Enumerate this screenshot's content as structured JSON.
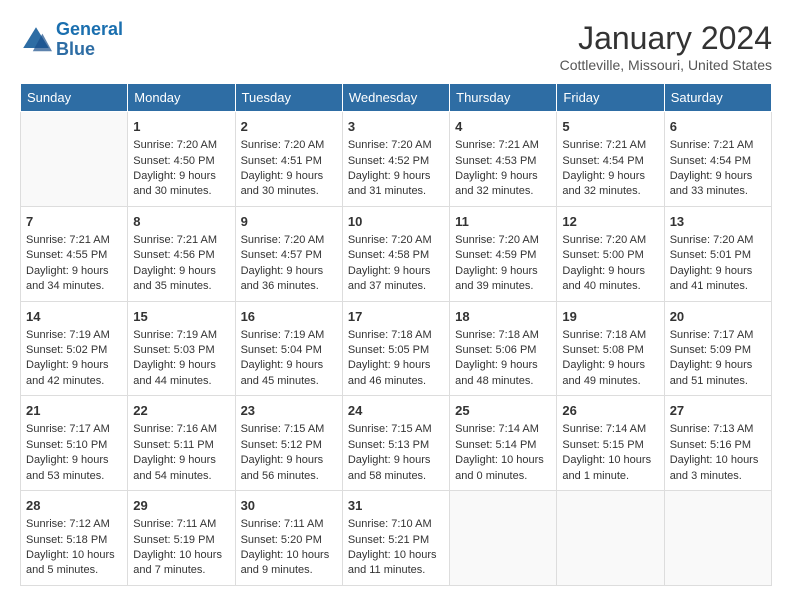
{
  "logo": {
    "line1": "General",
    "line2": "Blue"
  },
  "title": "January 2024",
  "subtitle": "Cottleville, Missouri, United States",
  "headers": [
    "Sunday",
    "Monday",
    "Tuesday",
    "Wednesday",
    "Thursday",
    "Friday",
    "Saturday"
  ],
  "weeks": [
    [
      {
        "day": "",
        "content": ""
      },
      {
        "day": "1",
        "content": "Sunrise: 7:20 AM\nSunset: 4:50 PM\nDaylight: 9 hours\nand 30 minutes."
      },
      {
        "day": "2",
        "content": "Sunrise: 7:20 AM\nSunset: 4:51 PM\nDaylight: 9 hours\nand 30 minutes."
      },
      {
        "day": "3",
        "content": "Sunrise: 7:20 AM\nSunset: 4:52 PM\nDaylight: 9 hours\nand 31 minutes."
      },
      {
        "day": "4",
        "content": "Sunrise: 7:21 AM\nSunset: 4:53 PM\nDaylight: 9 hours\nand 32 minutes."
      },
      {
        "day": "5",
        "content": "Sunrise: 7:21 AM\nSunset: 4:54 PM\nDaylight: 9 hours\nand 32 minutes."
      },
      {
        "day": "6",
        "content": "Sunrise: 7:21 AM\nSunset: 4:54 PM\nDaylight: 9 hours\nand 33 minutes."
      }
    ],
    [
      {
        "day": "7",
        "content": "Sunrise: 7:21 AM\nSunset: 4:55 PM\nDaylight: 9 hours\nand 34 minutes."
      },
      {
        "day": "8",
        "content": "Sunrise: 7:21 AM\nSunset: 4:56 PM\nDaylight: 9 hours\nand 35 minutes."
      },
      {
        "day": "9",
        "content": "Sunrise: 7:20 AM\nSunset: 4:57 PM\nDaylight: 9 hours\nand 36 minutes."
      },
      {
        "day": "10",
        "content": "Sunrise: 7:20 AM\nSunset: 4:58 PM\nDaylight: 9 hours\nand 37 minutes."
      },
      {
        "day": "11",
        "content": "Sunrise: 7:20 AM\nSunset: 4:59 PM\nDaylight: 9 hours\nand 39 minutes."
      },
      {
        "day": "12",
        "content": "Sunrise: 7:20 AM\nSunset: 5:00 PM\nDaylight: 9 hours\nand 40 minutes."
      },
      {
        "day": "13",
        "content": "Sunrise: 7:20 AM\nSunset: 5:01 PM\nDaylight: 9 hours\nand 41 minutes."
      }
    ],
    [
      {
        "day": "14",
        "content": "Sunrise: 7:19 AM\nSunset: 5:02 PM\nDaylight: 9 hours\nand 42 minutes."
      },
      {
        "day": "15",
        "content": "Sunrise: 7:19 AM\nSunset: 5:03 PM\nDaylight: 9 hours\nand 44 minutes."
      },
      {
        "day": "16",
        "content": "Sunrise: 7:19 AM\nSunset: 5:04 PM\nDaylight: 9 hours\nand 45 minutes."
      },
      {
        "day": "17",
        "content": "Sunrise: 7:18 AM\nSunset: 5:05 PM\nDaylight: 9 hours\nand 46 minutes."
      },
      {
        "day": "18",
        "content": "Sunrise: 7:18 AM\nSunset: 5:06 PM\nDaylight: 9 hours\nand 48 minutes."
      },
      {
        "day": "19",
        "content": "Sunrise: 7:18 AM\nSunset: 5:08 PM\nDaylight: 9 hours\nand 49 minutes."
      },
      {
        "day": "20",
        "content": "Sunrise: 7:17 AM\nSunset: 5:09 PM\nDaylight: 9 hours\nand 51 minutes."
      }
    ],
    [
      {
        "day": "21",
        "content": "Sunrise: 7:17 AM\nSunset: 5:10 PM\nDaylight: 9 hours\nand 53 minutes."
      },
      {
        "day": "22",
        "content": "Sunrise: 7:16 AM\nSunset: 5:11 PM\nDaylight: 9 hours\nand 54 minutes."
      },
      {
        "day": "23",
        "content": "Sunrise: 7:15 AM\nSunset: 5:12 PM\nDaylight: 9 hours\nand 56 minutes."
      },
      {
        "day": "24",
        "content": "Sunrise: 7:15 AM\nSunset: 5:13 PM\nDaylight: 9 hours\nand 58 minutes."
      },
      {
        "day": "25",
        "content": "Sunrise: 7:14 AM\nSunset: 5:14 PM\nDaylight: 10 hours\nand 0 minutes."
      },
      {
        "day": "26",
        "content": "Sunrise: 7:14 AM\nSunset: 5:15 PM\nDaylight: 10 hours\nand 1 minute."
      },
      {
        "day": "27",
        "content": "Sunrise: 7:13 AM\nSunset: 5:16 PM\nDaylight: 10 hours\nand 3 minutes."
      }
    ],
    [
      {
        "day": "28",
        "content": "Sunrise: 7:12 AM\nSunset: 5:18 PM\nDaylight: 10 hours\nand 5 minutes."
      },
      {
        "day": "29",
        "content": "Sunrise: 7:11 AM\nSunset: 5:19 PM\nDaylight: 10 hours\nand 7 minutes."
      },
      {
        "day": "30",
        "content": "Sunrise: 7:11 AM\nSunset: 5:20 PM\nDaylight: 10 hours\nand 9 minutes."
      },
      {
        "day": "31",
        "content": "Sunrise: 7:10 AM\nSunset: 5:21 PM\nDaylight: 10 hours\nand 11 minutes."
      },
      {
        "day": "",
        "content": ""
      },
      {
        "day": "",
        "content": ""
      },
      {
        "day": "",
        "content": ""
      }
    ]
  ]
}
